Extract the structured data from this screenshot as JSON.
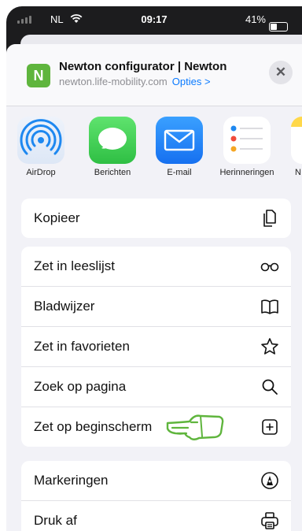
{
  "status": {
    "carrier": "NL",
    "time": "09:17",
    "battery": "41%"
  },
  "header": {
    "app_icon_letter": "N",
    "title": "Newton configurator | Newton",
    "url": "newton.life-mobility.com",
    "options_label": "Opties >",
    "close_symbol": "✕"
  },
  "apps": [
    {
      "label": "AirDrop",
      "icon": "airdrop-icon"
    },
    {
      "label": "Berichten",
      "icon": "messages-icon"
    },
    {
      "label": "E-mail",
      "icon": "mail-icon"
    },
    {
      "label": "Herinneringen",
      "icon": "reminders-icon"
    },
    {
      "label": "N",
      "icon": "notes-icon"
    }
  ],
  "actions": {
    "copy": "Kopieer",
    "reading_list": "Zet in leeslijst",
    "bookmark": "Bladwijzer",
    "favorites": "Zet in favorieten",
    "find": "Zoek op pagina",
    "home_screen": "Zet op beginscherm",
    "markup": "Markeringen",
    "print": "Druk af"
  },
  "colors": {
    "accent": "#0a7aff",
    "pointer_annotation": "#5fb53d"
  }
}
